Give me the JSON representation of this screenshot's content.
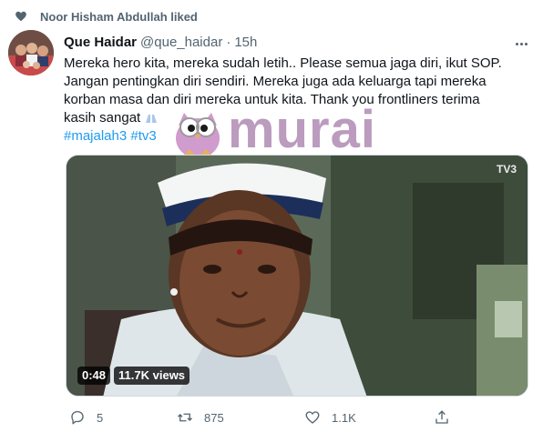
{
  "social_context": {
    "text": "Noor Hisham Abdullah liked",
    "icon": "heart-icon"
  },
  "tweet": {
    "author_name": "Que Haidar",
    "handle": "@que_haidar",
    "separator": "·",
    "time": "15h",
    "text_lines": [
      "Mereka hero kita, mereka sudah letih.. Please semua jaga diri, ikut SOP.",
      "Jangan  pentingkan diri sendiri. Mereka juga ada keluarga tapi mereka",
      "korban masa dan diri mereka untuk kita. Thank you frontliners terima",
      "kasih  sangat"
    ],
    "hashtags": [
      "#majalah3",
      "#tv3"
    ]
  },
  "watermark": {
    "text": "murai"
  },
  "media": {
    "duration": "0:48",
    "views": "11.7K views",
    "channel_logo": "TV3"
  },
  "actions": {
    "reply": {
      "icon": "reply-icon",
      "count": "5"
    },
    "retweet": {
      "icon": "retweet-icon",
      "count": "875"
    },
    "like": {
      "icon": "like-icon",
      "count": "1.1K"
    },
    "share": {
      "icon": "share-icon",
      "count": ""
    }
  },
  "colors": {
    "accent": "#1d9bf0",
    "secondary_text": "#536471",
    "watermark": "#b08ab3"
  }
}
